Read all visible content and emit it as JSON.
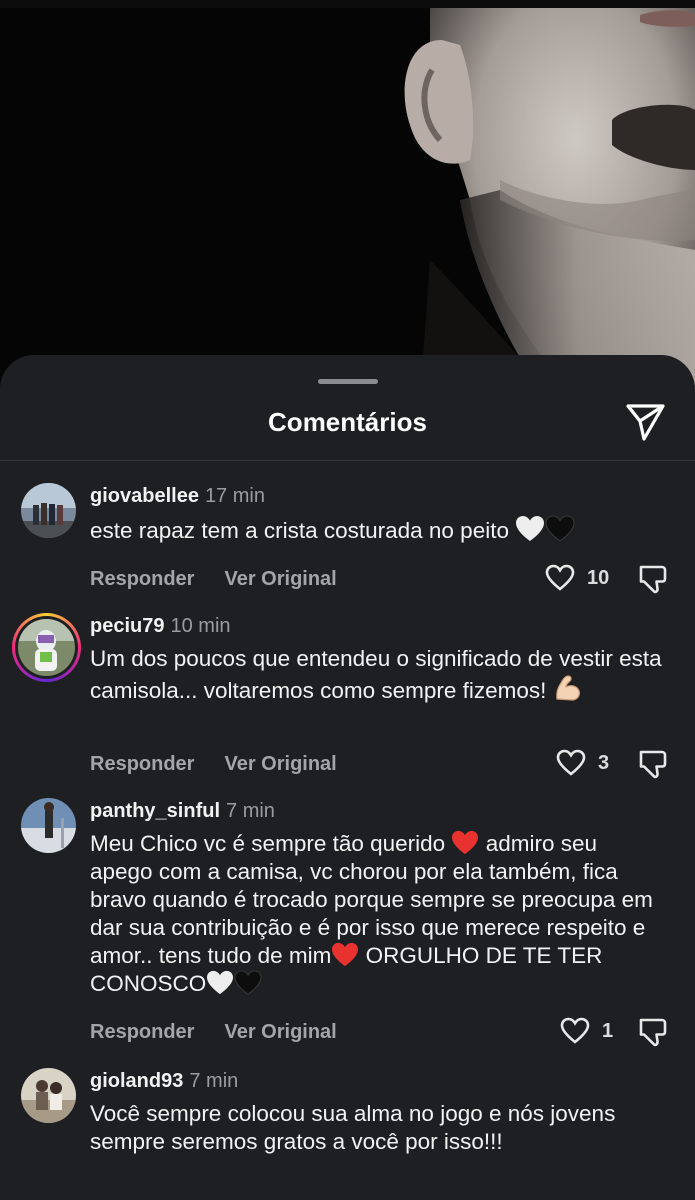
{
  "sheet": {
    "title": "Comentários"
  },
  "comments": [
    {
      "username": "giovabellee",
      "time": "17 min",
      "text": "este rapaz tem a crista costurada no peito",
      "reply_label": "Responder",
      "original_label": "Ver Original",
      "likes": "10",
      "emojis": [
        "white-heart",
        "black-heart"
      ]
    },
    {
      "username": "peciu79",
      "time": "10 min",
      "text": "Um dos poucos que entendeu o significado de vestir esta camisola... voltaremos como sempre fizemos!",
      "reply_label": "Responder",
      "original_label": "Ver Original",
      "likes": "3",
      "emojis": [
        "flexed-biceps"
      ]
    },
    {
      "username": "panthy_sinful",
      "time": "7 min",
      "text_1": "Meu Chico vc é sempre tão querido",
      "text_2": "admiro seu apego com a camisa, vc chorou por ela também, fica bravo quando é trocado porque sempre se preocupa em dar sua contribuição e é por isso que merece respeito e amor.. tens tudo de mim",
      "text_3": "ORGULHO DE TE TER CONOSCO",
      "reply_label": "Responder",
      "original_label": "Ver Original",
      "likes": "1",
      "emojis": [
        "red-heart",
        "red-heart",
        "white-heart",
        "black-heart"
      ]
    },
    {
      "username": "gioland93",
      "time": "7 min",
      "text": "Você sempre colocou sua alma no jogo e nós jovens sempre seremos gratos a você por isso!!!",
      "reply_label": "Responder",
      "original_label": "Ver Original"
    }
  ]
}
